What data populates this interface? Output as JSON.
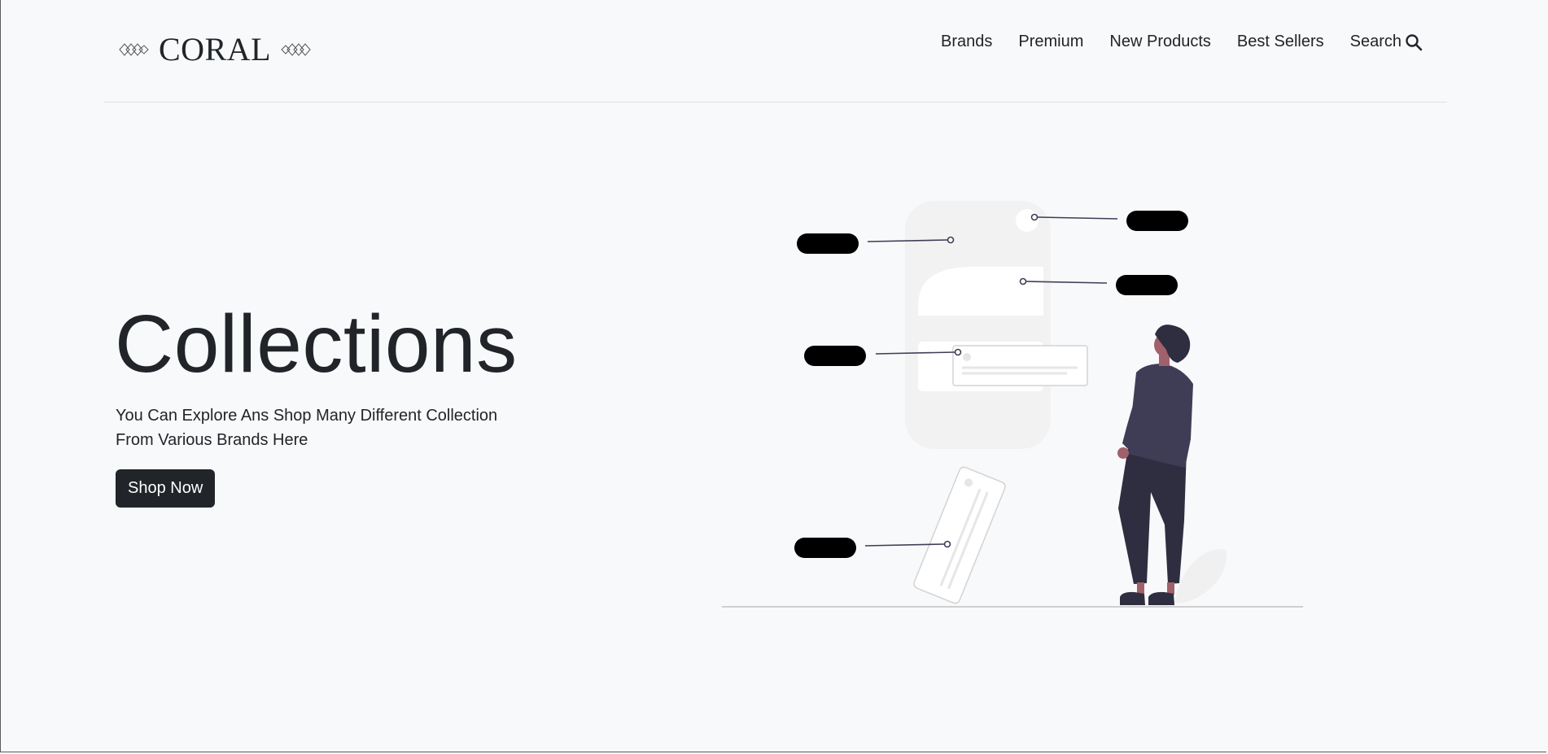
{
  "brand": {
    "name": "CORAL"
  },
  "nav": {
    "items": [
      {
        "label": "Brands"
      },
      {
        "label": "Premium"
      },
      {
        "label": "New Products"
      },
      {
        "label": "Best Sellers"
      }
    ],
    "search_label": "Search"
  },
  "hero": {
    "title": "Collections",
    "subtitle_line1": "You Can Explore Ans Shop Many Different Collection",
    "subtitle_line2": "From Various Brands Here",
    "cta_label": "Shop Now"
  },
  "colors": {
    "background": "#f8f9fa",
    "text": "#212529",
    "button": "#212529",
    "button_text": "#ffffff",
    "divider": "#dee2e6",
    "figure_dark": "#3f3d56",
    "figure_pants": "#2f2e41",
    "figure_skin": "#a0616a",
    "panel": "#f2f2f2"
  },
  "icons": {
    "brand_ornament": "diamond-ornament-icon",
    "search": "search-icon"
  }
}
